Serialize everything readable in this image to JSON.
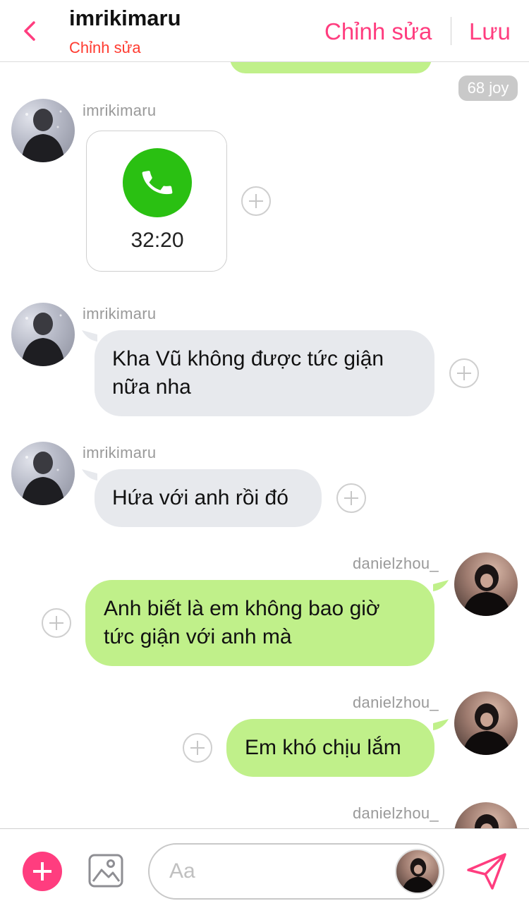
{
  "header": {
    "title": "imrikimaru",
    "subtitle": "Chỉnh sửa",
    "edit_label": "Chỉnh sửa",
    "save_label": "Lưu"
  },
  "chat": {
    "badge": "68 joy",
    "call": {
      "duration": "32:20"
    },
    "messages": [
      {
        "sender": "imrikimaru",
        "side": "left",
        "text": "Kha Vũ không được tức giận\nnữa nha"
      },
      {
        "sender": "imrikimaru",
        "side": "left",
        "text": "Hứa với anh rồi đó"
      },
      {
        "sender": "danielzhou_",
        "side": "right",
        "text": "Anh biết là em không bao giờ\ntức giận với anh mà"
      },
      {
        "sender": "danielzhou_",
        "side": "right",
        "text": "Em khó chịu lắm"
      },
      {
        "sender": "danielzhou_",
        "side": "right",
        "text": ""
      }
    ]
  },
  "footer": {
    "input_placeholder": "Aa"
  },
  "colors": {
    "accent": "#ff3d7f",
    "subtitle": "#ff3b30",
    "bubble_right": "#c0f08a",
    "bubble_left": "#e7e9ed",
    "call_green": "#2ac012"
  },
  "icons": {
    "back": "chevron-left-icon",
    "call": "phone-icon",
    "add": "plus-icon",
    "image": "image-icon",
    "send": "send-icon"
  }
}
